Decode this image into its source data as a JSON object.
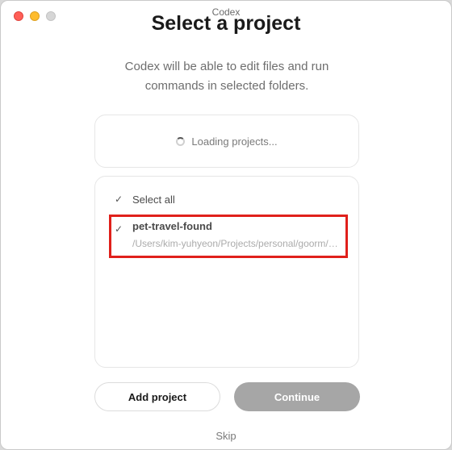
{
  "window": {
    "title": "Codex"
  },
  "dialog": {
    "heading": "Select a project",
    "subtitle": "Codex will be able to edit files and run commands in selected folders."
  },
  "loading": {
    "text": "Loading projects..."
  },
  "project_list": {
    "select_all_label": "Select all",
    "select_all_checked": true,
    "items": [
      {
        "name": "pet-travel-found",
        "path": "/Users/kim-yuhyeon/Projects/personal/goorm/pet-travel-found",
        "checked": true
      }
    ]
  },
  "actions": {
    "add_project_label": "Add project",
    "continue_label": "Continue",
    "skip_label": "Skip"
  },
  "icons": {
    "check": "check-icon",
    "spinner": "loading-spinner-icon"
  },
  "colors": {
    "highlight": "#e0201b",
    "continue_disabled": "#a6a6a6"
  }
}
